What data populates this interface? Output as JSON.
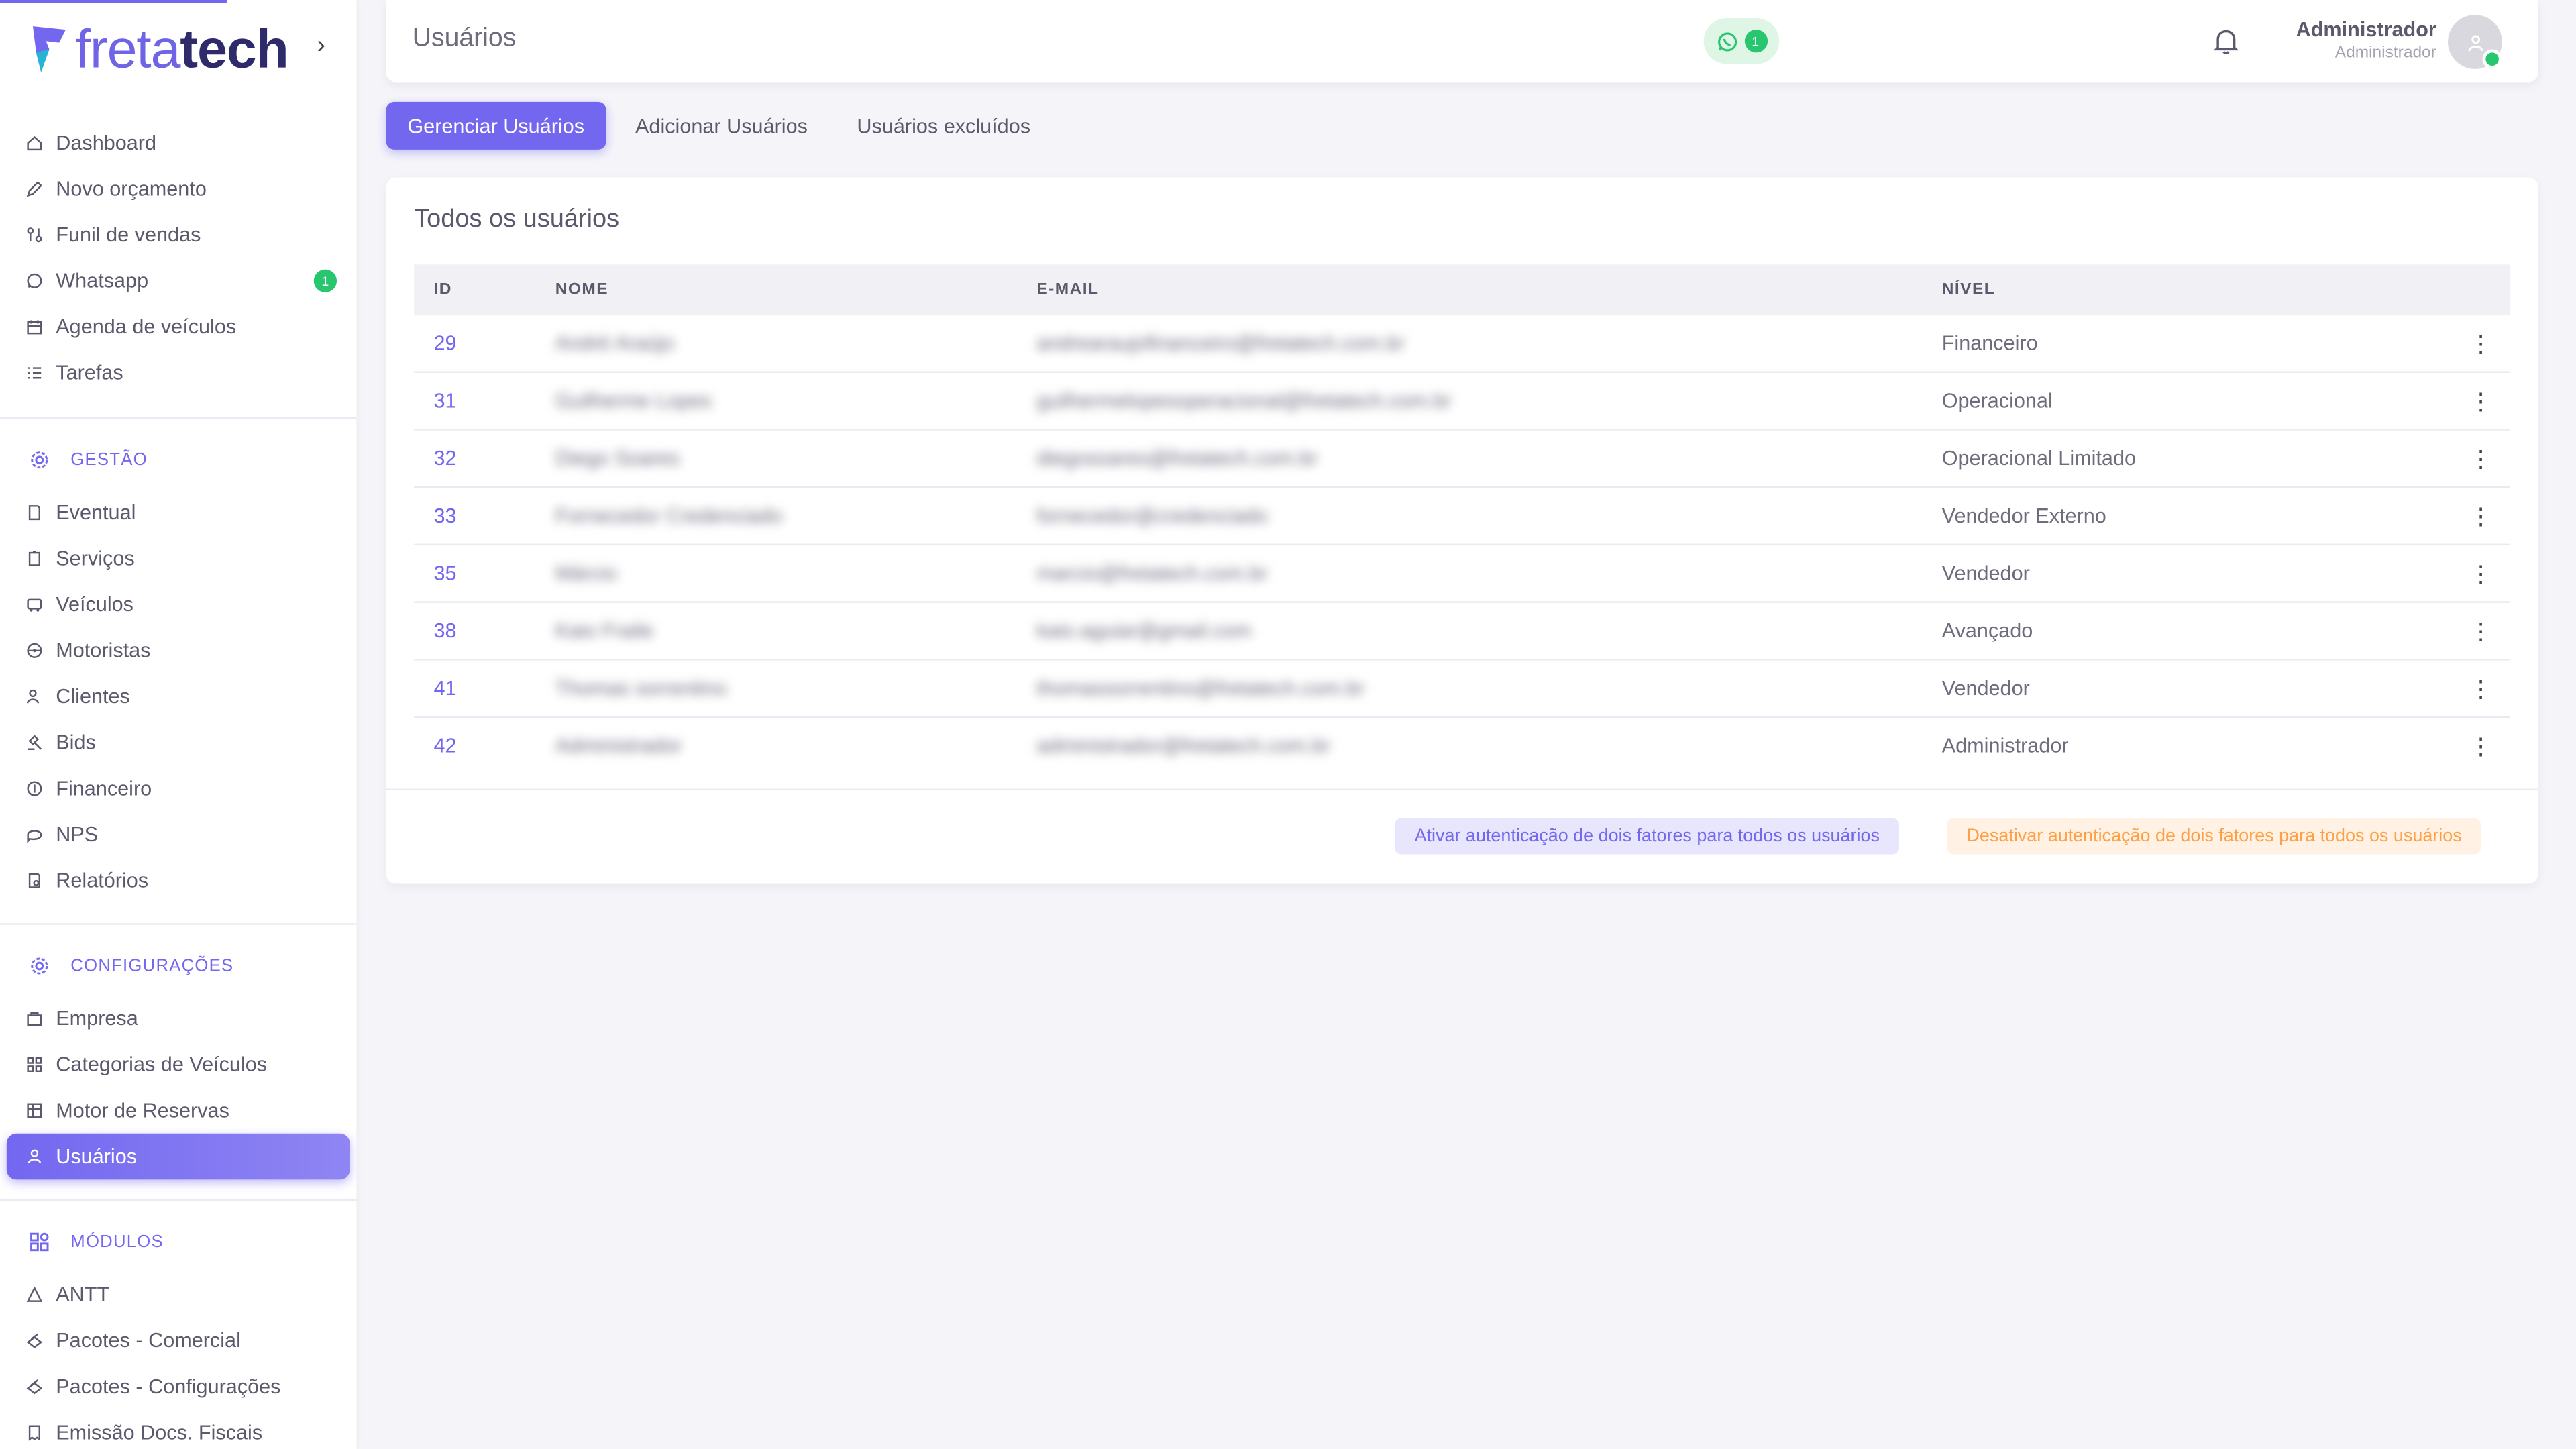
{
  "brand": {
    "logo_light": "freta",
    "logo_bold": "tech"
  },
  "sidebar": {
    "main_items": [
      {
        "label": "Dashboard",
        "icon": "home-icon"
      },
      {
        "label": "Novo orçamento",
        "icon": "edit-icon"
      },
      {
        "label": "Funil de vendas",
        "icon": "funnel-icon"
      },
      {
        "label": "Whatsapp",
        "icon": "whatsapp-icon",
        "badge": "1"
      },
      {
        "label": "Agenda de veículos",
        "icon": "calendar-icon"
      },
      {
        "label": "Tarefas",
        "icon": "list-icon"
      }
    ],
    "gestao": {
      "header": "GESTÃO",
      "items": [
        {
          "label": "Eventual",
          "icon": "file-icon"
        },
        {
          "label": "Serviços",
          "icon": "clipboard-icon"
        },
        {
          "label": "Veículos",
          "icon": "bus-icon"
        },
        {
          "label": "Motoristas",
          "icon": "steering-wheel-icon"
        },
        {
          "label": "Clientes",
          "icon": "users-icon"
        },
        {
          "label": "Bids",
          "icon": "gavel-icon"
        },
        {
          "label": "Financeiro",
          "icon": "coin-icon"
        },
        {
          "label": "NPS",
          "icon": "message-icon"
        },
        {
          "label": "Relatórios",
          "icon": "report-icon"
        }
      ]
    },
    "configuracoes": {
      "header": "CONFIGURAÇÕES",
      "items": [
        {
          "label": "Empresa",
          "icon": "building-icon"
        },
        {
          "label": "Categorias de Veículos",
          "icon": "category-icon"
        },
        {
          "label": "Motor de Reservas",
          "icon": "table-icon"
        },
        {
          "label": "Usuários",
          "icon": "user-icon"
        }
      ]
    },
    "modulos": {
      "header": "MÓDULOS",
      "items": [
        {
          "label": "ANTT",
          "icon": "triangle-icon"
        },
        {
          "label": "Pacotes - Comercial",
          "icon": "package-icon"
        },
        {
          "label": "Pacotes - Configurações",
          "icon": "package-icon"
        },
        {
          "label": "Emissão Docs. Fiscais",
          "icon": "receipt-icon"
        }
      ]
    }
  },
  "header": {
    "title": "Usuários",
    "whatsapp_count": "1",
    "user_name": "Administrador",
    "user_role": "Administrador"
  },
  "tabs": [
    "Gerenciar Usuários",
    "Adicionar Usuários",
    "Usuários excluídos"
  ],
  "card": {
    "title": "Todos os usuários",
    "columns": [
      "ID",
      "NOME",
      "E-MAIL",
      "NÍVEL"
    ],
    "rows": [
      {
        "id": "29",
        "name": "André Araújo",
        "email": "andrearaujofinanceiro@fretatech.com.br",
        "level": "Financeiro"
      },
      {
        "id": "31",
        "name": "Guilherme Lopes",
        "email": "guilhermelopesoperacional@fretatech.com.br",
        "level": "Operacional"
      },
      {
        "id": "32",
        "name": "Diego Soares",
        "email": "diegosoares@fretatech.com.br",
        "level": "Operacional Limitado"
      },
      {
        "id": "33",
        "name": "Fornecedor Credenciado",
        "email": "fornecedor@credenciado",
        "level": "Vendedor Externo"
      },
      {
        "id": "35",
        "name": "Márcio",
        "email": "marcio@fretatech.com.br",
        "level": "Vendedor"
      },
      {
        "id": "38",
        "name": "Kaio Fraile",
        "email": "kaio.aguiar@gmail.com",
        "level": "Avançado"
      },
      {
        "id": "41",
        "name": "Thomas sorrentino",
        "email": "thomassorrentino@fretatech.com.br",
        "level": "Vendedor"
      },
      {
        "id": "42",
        "name": "Administrador",
        "email": "administrador@fretatech.com.br",
        "level": "Administrador"
      }
    ],
    "btn_enable_2fa": "Ativar autenticação de dois fatores para todos os usuários",
    "btn_disable_2fa": "Desativar autenticação de dois fatores para todos os usuários"
  },
  "colors": {
    "accent": "#7367f0",
    "success": "#28c76f",
    "warning": "#ff9f43"
  }
}
